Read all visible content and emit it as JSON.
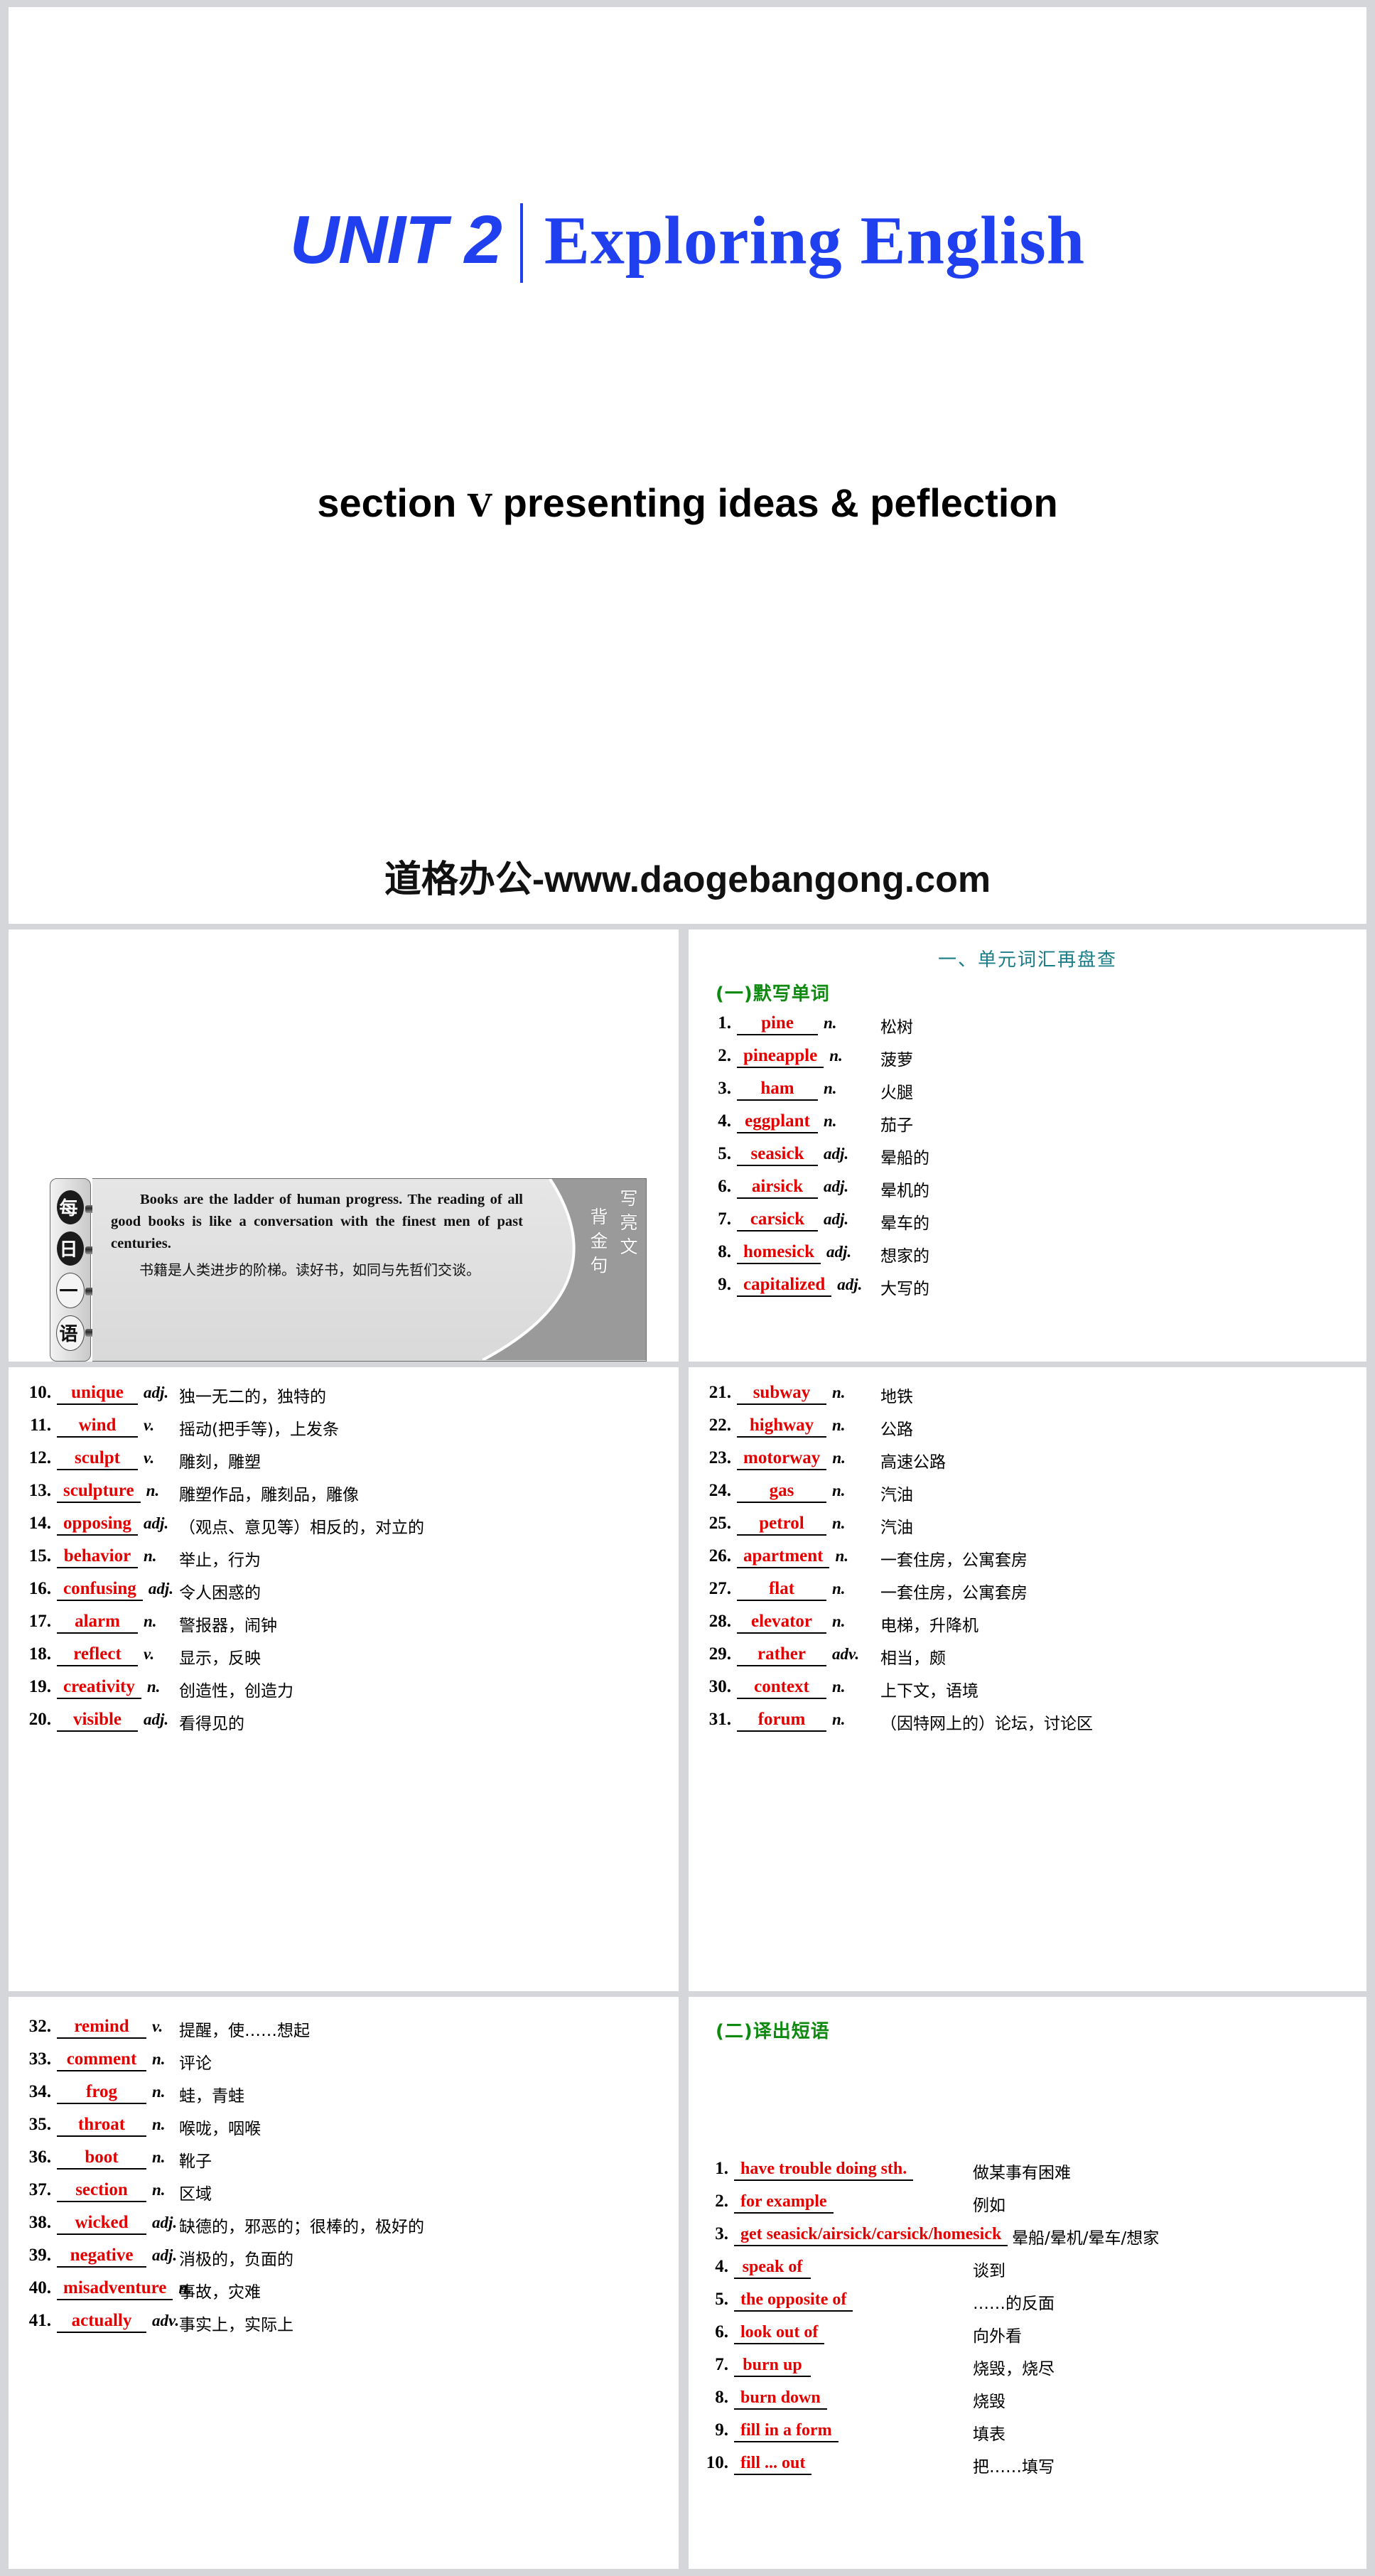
{
  "title_slide": {
    "unit_tag": "UNIT 2",
    "unit_name": "Exploring English",
    "section_pre": "section",
    "section_roman": "Ⅴ",
    "section_post": "presenting ideas &  peflection",
    "watermark": "道格办公-www.daogebangong.com",
    "accent_blue": "#2040ef"
  },
  "quote_card": {
    "side_tab_chars": [
      "每",
      "日",
      "一",
      "语"
    ],
    "english": "Books are the ladder of human progress. The reading of all good books is like a conversation with the finest men of past centuries.",
    "chinese": "书籍是人类进步的阶梯。读好书，如同与先哲们交谈。",
    "label_col1": "写亮文",
    "label_col2": "背金句"
  },
  "vocab_section": {
    "heading": "一、单元词汇再盘查",
    "sub_heading_words": "(一)默写单词",
    "sub_heading_phrases": "(二)译出短语",
    "heading_color": "#1a7d88",
    "sub_heading_color": "#0f8a10",
    "word_color": "#e30000"
  },
  "words": [
    {
      "num": "1.",
      "word": "pine",
      "pos": "n.",
      "cn": "松树"
    },
    {
      "num": "2.",
      "word": "pineapple",
      "pos": "n.",
      "cn": "菠萝"
    },
    {
      "num": "3.",
      "word": "ham",
      "pos": "n.",
      "cn": "火腿"
    },
    {
      "num": "4.",
      "word": "eggplant",
      "pos": "n.",
      "cn": "茄子"
    },
    {
      "num": "5.",
      "word": "seasick",
      "pos": "adj.",
      "cn": "晕船的"
    },
    {
      "num": "6.",
      "word": "airsick",
      "pos": "adj.",
      "cn": "晕机的"
    },
    {
      "num": "7.",
      "word": "carsick",
      "pos": "adj.",
      "cn": "晕车的"
    },
    {
      "num": "8.",
      "word": "homesick",
      "pos": "adj.",
      "cn": "想家的"
    },
    {
      "num": "9.",
      "word": "capitalized",
      "pos": "adj.",
      "cn": "大写的"
    },
    {
      "num": "10.",
      "word": "unique",
      "pos": "adj.",
      "cn": "独一无二的，独特的"
    },
    {
      "num": "11.",
      "word": "wind",
      "pos": "v.",
      "cn": "摇动(把手等)，上发条"
    },
    {
      "num": "12.",
      "word": "sculpt",
      "pos": "v.",
      "cn": "雕刻，雕塑"
    },
    {
      "num": "13.",
      "word": "sculpture",
      "pos": "n.",
      "cn": "雕塑作品，雕刻品，雕像"
    },
    {
      "num": "14.",
      "word": "opposing",
      "pos": "adj.",
      "cn": "（观点、意见等）相反的，对立的"
    },
    {
      "num": "15.",
      "word": "behavior",
      "pos": "n.",
      "cn": "举止，行为"
    },
    {
      "num": "16.",
      "word": "confusing",
      "pos": "adj.",
      "cn": "令人困惑的"
    },
    {
      "num": "17.",
      "word": "alarm",
      "pos": "n.",
      "cn": "警报器，闹钟"
    },
    {
      "num": "18.",
      "word": "reflect",
      "pos": "v.",
      "cn": "显示，反映"
    },
    {
      "num": "19.",
      "word": "creativity",
      "pos": "n.",
      "cn": "创造性，创造力"
    },
    {
      "num": "20.",
      "word": "visible",
      "pos": "adj.",
      "cn": "看得见的"
    },
    {
      "num": "21.",
      "word": "subway",
      "pos": "n.",
      "cn": "地铁"
    },
    {
      "num": "22.",
      "word": "highway",
      "pos": "n.",
      "cn": "公路"
    },
    {
      "num": "23.",
      "word": "motorway",
      "pos": "n.",
      "cn": "高速公路"
    },
    {
      "num": "24.",
      "word": "gas",
      "pos": "n.",
      "cn": "汽油"
    },
    {
      "num": "25.",
      "word": "petrol",
      "pos": "n.",
      "cn": "汽油"
    },
    {
      "num": "26.",
      "word": "apartment",
      "pos": "n.",
      "cn": "一套住房，公寓套房"
    },
    {
      "num": "27.",
      "word": "flat",
      "pos": "n.",
      "cn": "一套住房，公寓套房"
    },
    {
      "num": "28.",
      "word": "elevator",
      "pos": "n.",
      "cn": "电梯，升降机"
    },
    {
      "num": "29.",
      "word": "rather",
      "pos": "adv.",
      "cn": "相当，颇"
    },
    {
      "num": "30.",
      "word": "context",
      "pos": "n.",
      "cn": "上下文，语境"
    },
    {
      "num": "31.",
      "word": "forum",
      "pos": "n.",
      "cn": "（因特网上的）论坛，讨论区"
    },
    {
      "num": "32.",
      "word": "remind",
      "pos": "v.",
      "cn": "提醒，使……想起"
    },
    {
      "num": "33.",
      "word": "comment",
      "pos": "n.",
      "cn": "评论"
    },
    {
      "num": "34.",
      "word": "frog",
      "pos": "n.",
      "cn": "蛙，青蛙"
    },
    {
      "num": "35.",
      "word": "throat",
      "pos": "n.",
      "cn": "喉咙，咽喉"
    },
    {
      "num": "36.",
      "word": "boot",
      "pos": "n.",
      "cn": "靴子"
    },
    {
      "num": "37.",
      "word": "section",
      "pos": "n.",
      "cn": "区域"
    },
    {
      "num": "38.",
      "word": "wicked",
      "pos": "adj.",
      "cn": "缺德的，邪恶的；很棒的，极好的"
    },
    {
      "num": "39.",
      "word": "negative",
      "pos": "adj.",
      "cn": "消极的，负面的"
    },
    {
      "num": "40.",
      "word": "misadventure",
      "pos": "n.",
      "cn": "事故，灾难"
    },
    {
      "num": "41.",
      "word": "actually",
      "pos": "adv.",
      "cn": "事实上，实际上"
    }
  ],
  "phrases": [
    {
      "num": "1.",
      "word": "have trouble doing sth.",
      "cn": "做某事有困难"
    },
    {
      "num": "2.",
      "word": "for example",
      "cn": "例如"
    },
    {
      "num": "3.",
      "word": "get seasick/airsick/carsick/homesick",
      "cn": "晕船/晕机/晕车/想家"
    },
    {
      "num": "4.",
      "word": "speak of",
      "cn": "谈到"
    },
    {
      "num": "5.",
      "word": "the opposite of",
      "cn": "……的反面"
    },
    {
      "num": "6.",
      "word": "look out of",
      "cn": "向外看"
    },
    {
      "num": "7.",
      "word": "burn up",
      "cn": "烧毁，烧尽"
    },
    {
      "num": "8.",
      "word": "burn down",
      "cn": "烧毁"
    },
    {
      "num": "9.",
      "word": "fill in a form",
      "cn": "填表"
    },
    {
      "num": "10.",
      "word": "fill ... out",
      "cn": "把……填写"
    }
  ]
}
